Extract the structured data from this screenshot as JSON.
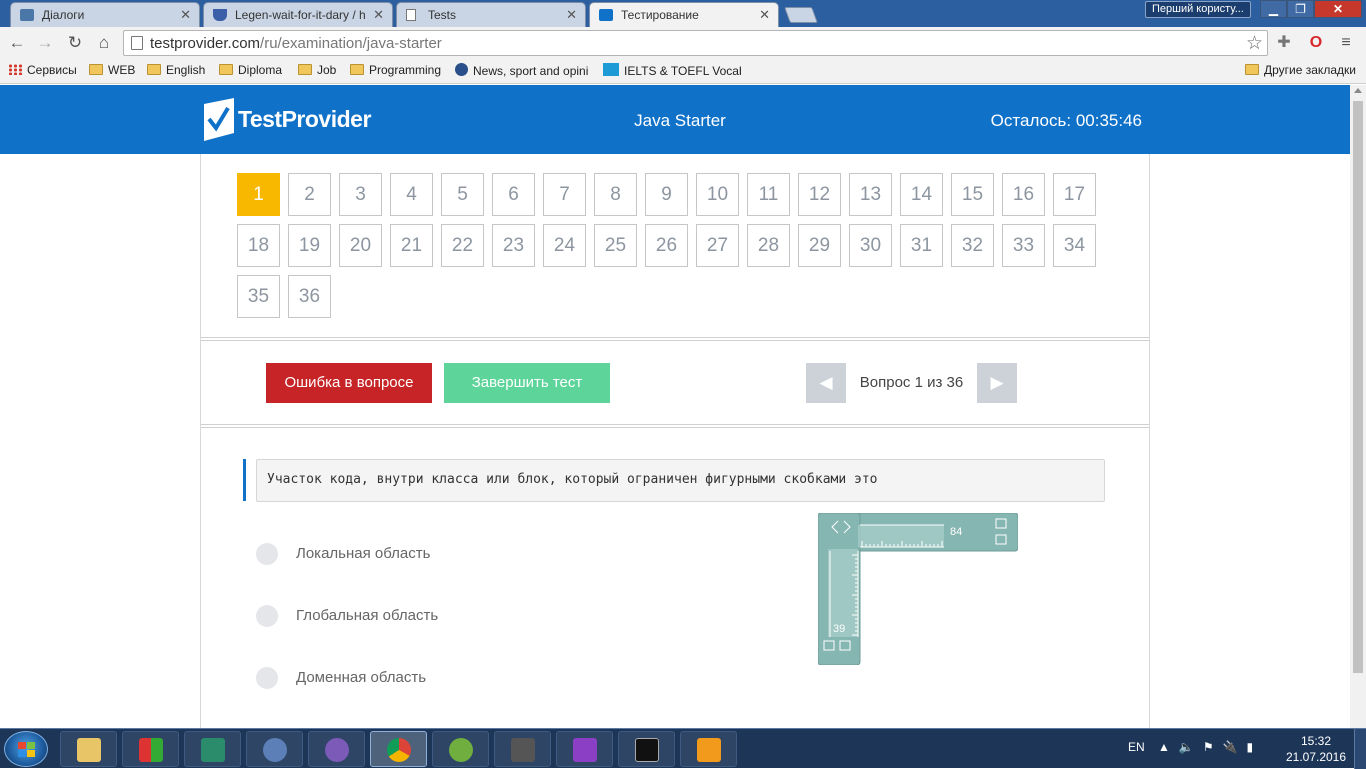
{
  "browser": {
    "tabs": [
      {
        "title": "Діалоги",
        "active": false
      },
      {
        "title": "Legen-wait-for-it-dary / h",
        "active": false
      },
      {
        "title": "Tests",
        "active": false
      },
      {
        "title": "Тестирование",
        "active": true
      }
    ],
    "profile_name": "Перший користу...",
    "url_domain": "testprovider.com",
    "url_path": "/ru/examination/java-starter",
    "bookmarks": [
      {
        "label": "Сервисы",
        "icon": "apps-icon"
      },
      {
        "label": "WEB",
        "icon": "folder-icon"
      },
      {
        "label": "English",
        "icon": "folder-icon"
      },
      {
        "label": "Diploma",
        "icon": "folder-icon"
      },
      {
        "label": "Job",
        "icon": "folder-icon"
      },
      {
        "label": "Programming",
        "icon": "folder-icon"
      },
      {
        "label": "News, sport and opini",
        "icon": "globe-icon"
      },
      {
        "label": "IELTS & TOEFL Vocab",
        "icon": "ev-icon"
      }
    ],
    "other_bookmarks": "Другие закладки"
  },
  "site": {
    "logo_text": "TestProvider",
    "test_title": "Java Starter",
    "timer": "Осталось: 00:35:46",
    "accent_color": "#0f71c8",
    "current_color": "#f8b800"
  },
  "questions": {
    "current": 1,
    "total": 36,
    "numbers": [
      "1",
      "2",
      "3",
      "4",
      "5",
      "6",
      "7",
      "8",
      "9",
      "10",
      "11",
      "12",
      "13",
      "14",
      "15",
      "16",
      "17",
      "18",
      "19",
      "20",
      "21",
      "22",
      "23",
      "24",
      "25",
      "26",
      "27",
      "28",
      "29",
      "30",
      "31",
      "32",
      "33",
      "34",
      "35",
      "36"
    ]
  },
  "actions": {
    "error_button": "Ошибка в вопросе",
    "finish_button": "Завершить тест",
    "prev_glyph": "◀",
    "next_glyph": "▶",
    "pager_text": "Вопрос 1 из 36"
  },
  "question": {
    "text": "Участок кода, внутри класса или блок, который ограничен фигурными скобками это",
    "answers": [
      "Локальная область",
      "Глобальная область",
      "Доменная область"
    ]
  },
  "ruler_overlay": {
    "horizontal_value": "84",
    "vertical_value": "39"
  },
  "taskbar": {
    "language": "EN",
    "time": "15:32",
    "date": "21.07.2016"
  }
}
